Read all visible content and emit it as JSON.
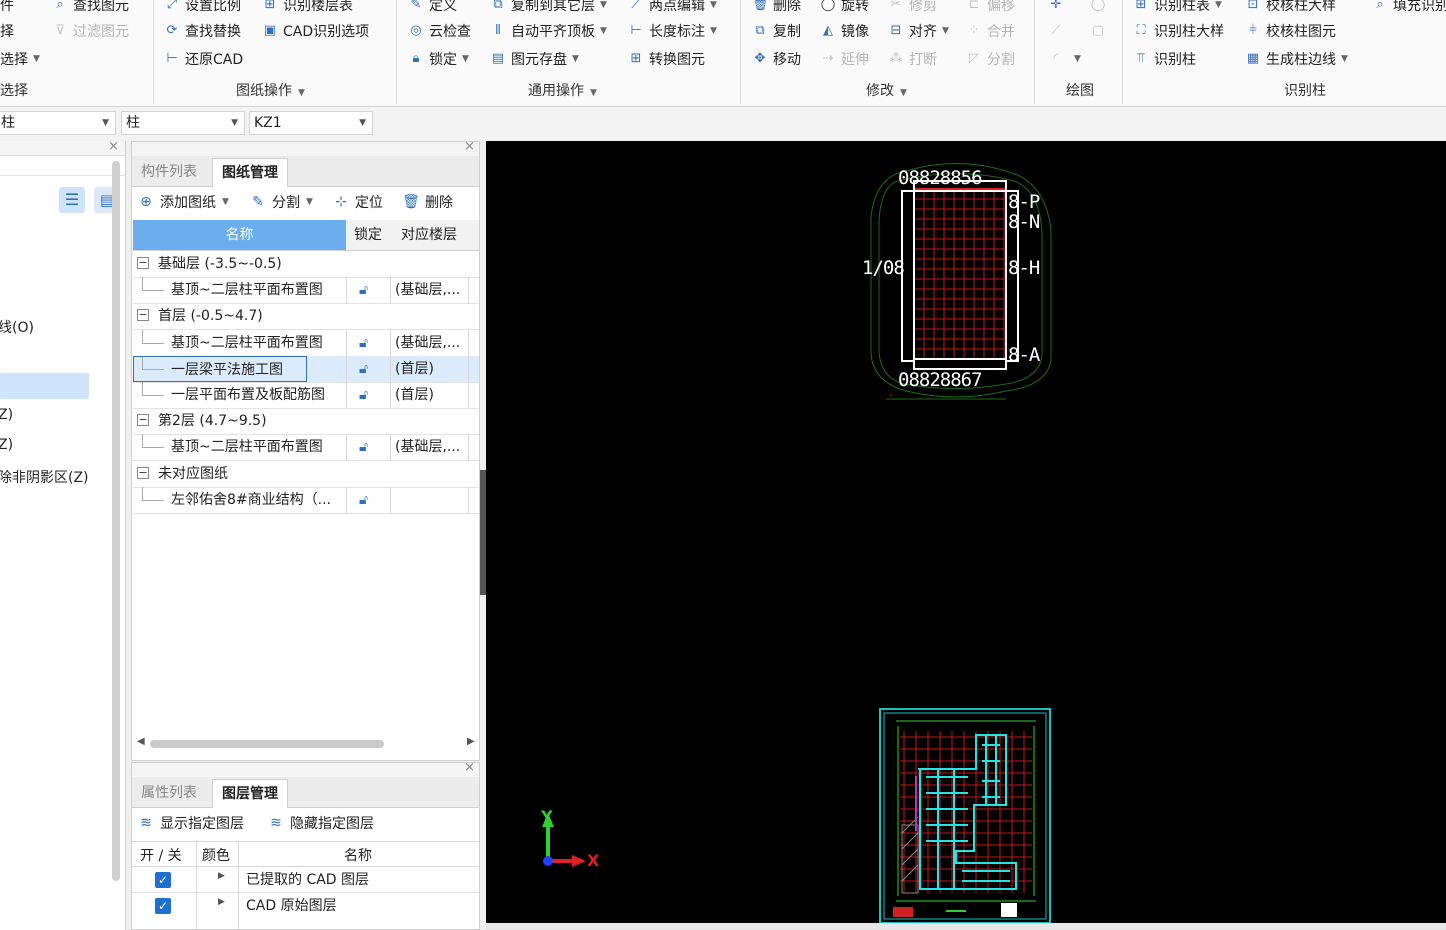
{
  "ribbon": {
    "col1": [
      "件",
      "择",
      "选择",
      "选择"
    ],
    "col2": {
      "find": "查找图元",
      "filter": "过滤图元"
    },
    "col3": {
      "set_scale": "设置比例",
      "find_replace": "查找替换",
      "restore_cad": "还原CAD"
    },
    "col4": {
      "identify_floor_table": "识别楼层表",
      "cad_options": "CAD识别选项"
    },
    "group_drawing_ops": "图纸操作",
    "col5": {
      "define": "定义",
      "cloud_check": "云检查",
      "lock": "锁定"
    },
    "col6": {
      "copy_to_floor": "复制到其它层",
      "auto_align": "自动平齐顶板",
      "elem_save": "图元存盘"
    },
    "col7": {
      "two_point_edit": "两点编辑",
      "length_dim": "长度标注",
      "convert": "转换图元"
    },
    "group_common_ops": "通用操作",
    "col8": {
      "delete": "删除",
      "copy": "复制",
      "move": "移动"
    },
    "col9": {
      "rotate": "旋转",
      "mirror": "镜像",
      "extend": "延伸"
    },
    "col10": {
      "trim": "修剪",
      "align": "对齐",
      "break": "打断"
    },
    "col11": {
      "offset": "偏移",
      "merge": "合并",
      "split": "分割"
    },
    "group_modify": "修改",
    "group_draw": "绘图",
    "col12": {
      "id_col_table": "识别柱表",
      "id_col_detail": "识别柱大样",
      "id_col": "识别柱"
    },
    "col13": {
      "check_col_detail": "校核柱大样",
      "check_col_elem": "校核柱图元",
      "gen_col_edge": "生成柱边线"
    },
    "col14": {
      "fill_id": "填充识别"
    },
    "group_identify_col": "识别柱"
  },
  "selectors": {
    "s1": "柱",
    "s2": "柱",
    "s3": "KZ1"
  },
  "left_panel": {
    "items": [
      "线(O)",
      "Z)",
      "Z)",
      "除非阴影区(Z)"
    ]
  },
  "mid_panel": {
    "tabs": {
      "component_list": "构件列表",
      "drawing_mgmt": "图纸管理"
    },
    "toolbar": {
      "add": "添加图纸",
      "split": "分割",
      "locate": "定位",
      "delete": "删除"
    },
    "columns": {
      "name": "名称",
      "lock": "锁定",
      "floor": "对应楼层"
    },
    "rows": [
      {
        "type": "group",
        "name": "基础层 (-3.5~-0.5)"
      },
      {
        "type": "item",
        "name": "基顶~二层柱平面布置图",
        "floor": "(基础层,..."
      },
      {
        "type": "group",
        "name": "首层 (-0.5~4.7)"
      },
      {
        "type": "item",
        "name": "基顶~二层柱平面布置图",
        "floor": "(基础层,..."
      },
      {
        "type": "item",
        "name": "一层梁平法施工图",
        "floor": "(首层)"
      },
      {
        "type": "item",
        "name": "一层平面布置及板配筋图",
        "floor": "(首层)"
      },
      {
        "type": "group",
        "name": "第2层 (4.7~9.5)"
      },
      {
        "type": "item",
        "name": "基顶~二层柱平面布置图",
        "floor": "(基础层,..."
      },
      {
        "type": "group",
        "name": "未对应图纸"
      },
      {
        "type": "item",
        "name": "左邻佑舍8#商业结构（...",
        "floor": ""
      }
    ]
  },
  "bottom_panel": {
    "tabs": {
      "props": "属性列表",
      "layer_mgmt": "图层管理"
    },
    "toolbar": {
      "show": "显示指定图层",
      "hide": "隐藏指定图层"
    },
    "columns": {
      "toggle": "开 / 关",
      "color": "颜色",
      "name": "名称"
    },
    "rows": [
      {
        "name": "已提取的 CAD 图层"
      },
      {
        "name": "CAD 原始图层"
      }
    ]
  },
  "canvas": {
    "top_labels": {
      "top": "08828856",
      "bottom": "08828867",
      "right_top": "8-P",
      "right_n": "8-N",
      "right_h": "8-H",
      "right_a": "8-A",
      "left": "1/08"
    },
    "axis": {
      "x": "X",
      "y": "Y"
    }
  },
  "colors": {
    "accent": "#2e6fbf",
    "selected_header": "#6aaef0",
    "canvas_bg": "#000000"
  }
}
